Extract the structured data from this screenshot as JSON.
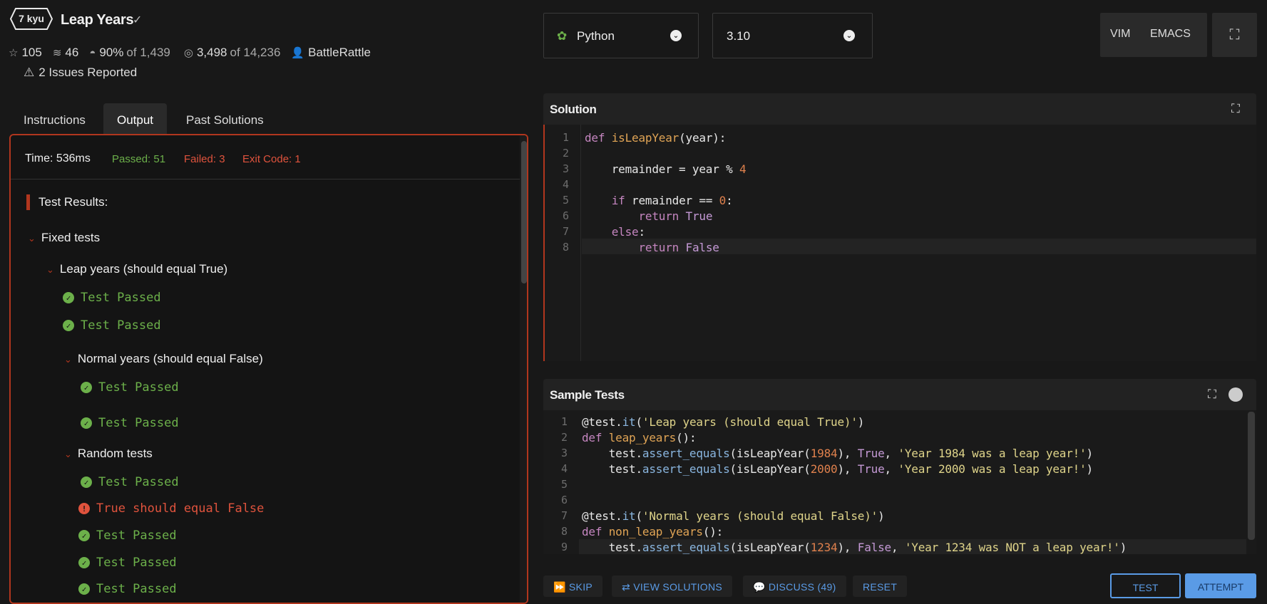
{
  "kata": {
    "rank": "7 kyu",
    "title": "Leap Years",
    "stars": "105",
    "collections": "46",
    "satisfaction": "90%",
    "satisfaction_of": "of 1,439",
    "completed": "3,498",
    "completed_of": "of 14,236",
    "author": "BattleRattle",
    "issues": "2 Issues Reported"
  },
  "tabs": [
    "Instructions",
    "Output",
    "Past Solutions"
  ],
  "output": {
    "time": "Time: 536ms",
    "passed": "Passed: 51",
    "failed": "Failed: 3",
    "exit_code": "Exit Code: 1",
    "results_title": "Test Results:",
    "fixed_tests": "Fixed tests",
    "group_leap": "Leap years (should equal True)",
    "group_normal": "Normal years (should equal False)",
    "group_random": "Random tests",
    "pass_text": "Test Passed",
    "fail_text": "True should equal False"
  },
  "language": {
    "name": "Python",
    "version": "3.10"
  },
  "modes": {
    "vim": "VIM",
    "emacs": "EMACS"
  },
  "solution": {
    "title": "Solution",
    "line_numbers": [
      "1",
      "2",
      "3",
      "4",
      "5",
      "6",
      "7",
      "8"
    ]
  },
  "sample_tests": {
    "title": "Sample Tests",
    "line_numbers": [
      "1",
      "2",
      "3",
      "4",
      "5",
      "6",
      "7",
      "8",
      "9"
    ]
  },
  "buttons": {
    "skip": "SKIP",
    "view_solutions": "VIEW SOLUTIONS",
    "discuss": "DISCUSS (49)",
    "reset": "RESET",
    "test": "TEST",
    "attempt": "ATTEMPT"
  },
  "colors": {
    "accent": "#b1361e",
    "pass": "#6cb04a",
    "fail": "#e0533d",
    "link": "#5a9be6"
  }
}
